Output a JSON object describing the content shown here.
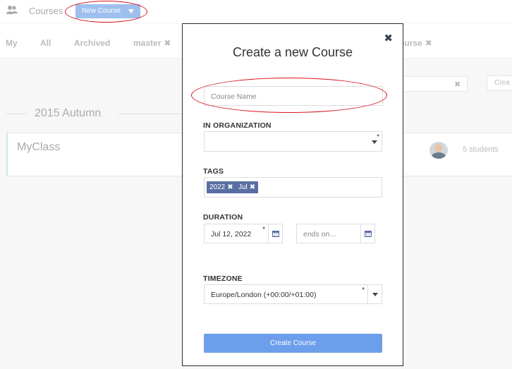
{
  "topbar": {
    "users_icon": "users-icon",
    "courses_label": "Courses",
    "new_course_label": "New Course"
  },
  "tabs": [
    {
      "label": "My"
    },
    {
      "label": "All"
    },
    {
      "label": "Archived"
    },
    {
      "label": "master"
    },
    {
      "label": "ourse"
    }
  ],
  "filter": {
    "create_label": "Crea"
  },
  "semester": {
    "title": "2015 Autumn"
  },
  "course_card": {
    "title": "MyClass",
    "students": "5 students"
  },
  "modal": {
    "title": "Create a new Course",
    "close": "✖",
    "course_name_placeholder": "Course Name",
    "organization_label": "IN ORGANIZATION",
    "tags_label": "TAGS",
    "tags": [
      {
        "label": "2022"
      },
      {
        "label": "Jul"
      }
    ],
    "duration_label": "DURATION",
    "start_date": "Jul 12, 2022",
    "end_placeholder": "ends on...",
    "timezone_label": "TIMEZONE",
    "timezone_value": "Europe/London (+00:00/+01:00)",
    "required_mark": "*",
    "submit_label": "Create Course"
  },
  "colors": {
    "accent": "#6d9eeb",
    "tag_bg": "#5a6ea3",
    "highlight": "#d8141b"
  }
}
